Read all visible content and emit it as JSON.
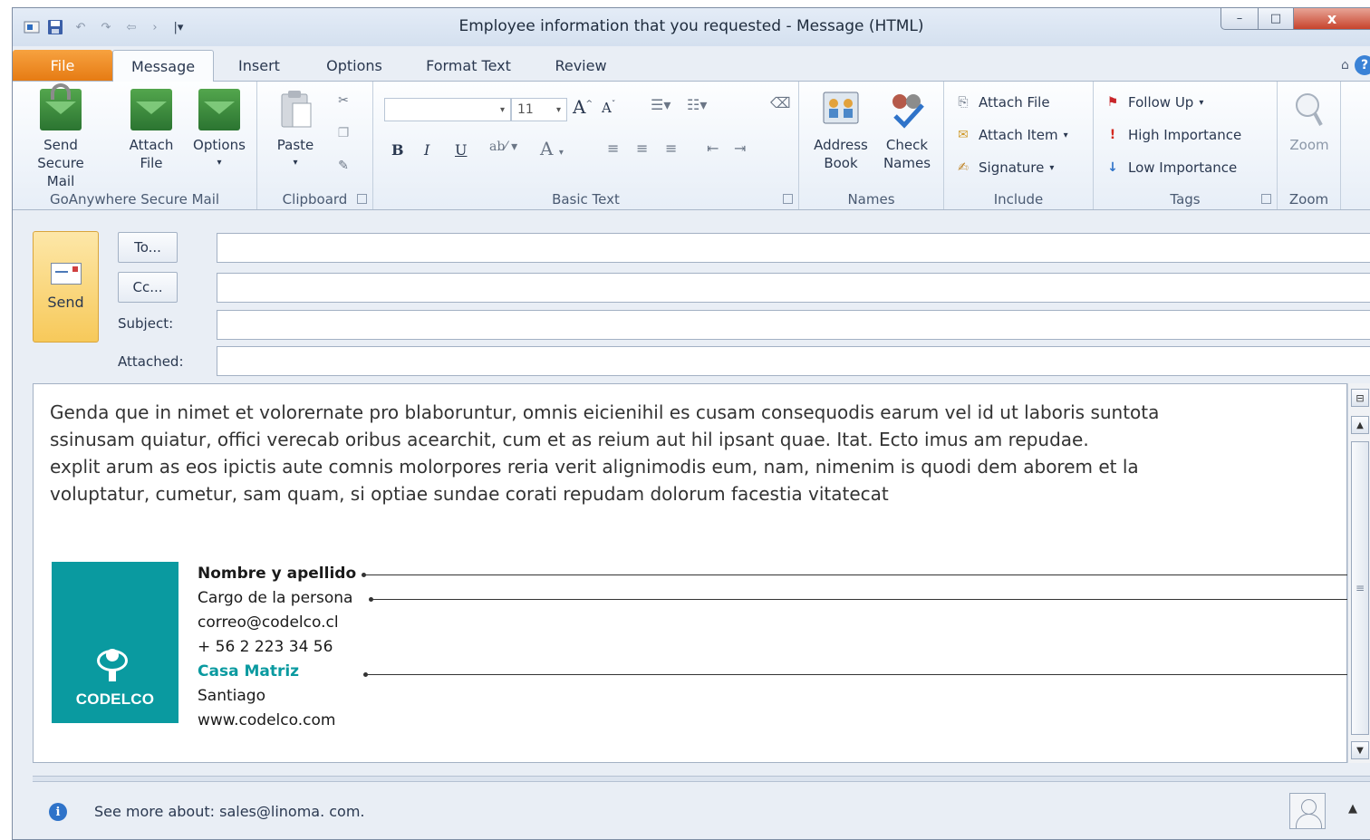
{
  "window": {
    "title": "Employee information that you requested  -  Message (HTML)",
    "minimize": "–",
    "maximize": "□",
    "close": "x"
  },
  "tabs": [
    "File",
    "Message",
    "Insert",
    "Options",
    "Format Text",
    "Review"
  ],
  "ribbon": {
    "groups": {
      "secure_mail": {
        "label": "GoAnywhere Secure Mail",
        "send_secure": [
          "Send",
          "Secure Mail"
        ],
        "attach_file": [
          "Attach",
          "File"
        ],
        "options": "Options"
      },
      "clipboard": {
        "label": "Clipboard",
        "paste": "Paste"
      },
      "basic_text": {
        "label": "Basic Text",
        "font_size": "11",
        "bold": "B",
        "italic": "I",
        "underline": "U"
      },
      "names": {
        "label": "Names",
        "address_book": [
          "Address",
          "Book"
        ],
        "check_names": [
          "Check",
          "Names"
        ]
      },
      "include": {
        "label": "Include",
        "attach_file": "Attach File",
        "attach_item": "Attach Item",
        "signature": "Signature"
      },
      "tags": {
        "label": "Tags",
        "follow_up": "Follow Up",
        "high_importance": "High Importance",
        "low_importance": "Low Importance"
      },
      "zoom": {
        "label": "Zoom",
        "zoom": "Zoom"
      }
    }
  },
  "header": {
    "send": "Send",
    "to_button": "To...",
    "cc_button": "Cc...",
    "subject_label": "Subject:",
    "attached_label": "Attached:",
    "to_value": "",
    "cc_value": "",
    "subject_value": "",
    "attached_value": ""
  },
  "body": {
    "lines": [
      "Genda que in nimet et volorernate pro blaboruntur, omnis eicienihil es cusam consequodis earum vel id ut laboris suntota",
      "ssinusam quiatur, offici verecab oribus acearchit, cum et as reium aut hil ipsant quae. Itat. Ecto imus am repudae.",
      "explit arum as eos ipictis aute comnis molorpores reria verit alignimodis eum, nam, nimenim is quodi dem aborem et la",
      "voluptatur, cumetur, sam quam, si optiae sundae corati repudam dolorum facestia vitatecat"
    ]
  },
  "signature": {
    "logo_text": "CODELCO",
    "name": "Nombre y apellido",
    "role": "Cargo de la persona",
    "email": "correo@codelco.cl",
    "phone": "+ 56 2 223 34 56",
    "office": "Casa Matriz",
    "city": "Santiago",
    "website": "www.codelco.com"
  },
  "status": {
    "info_text": "See more about: sales@linoma. com."
  },
  "colors": {
    "file_tab": "#e67b13",
    "send_tile": "#f7c95a",
    "codelco_teal": "#0a9aa0"
  }
}
